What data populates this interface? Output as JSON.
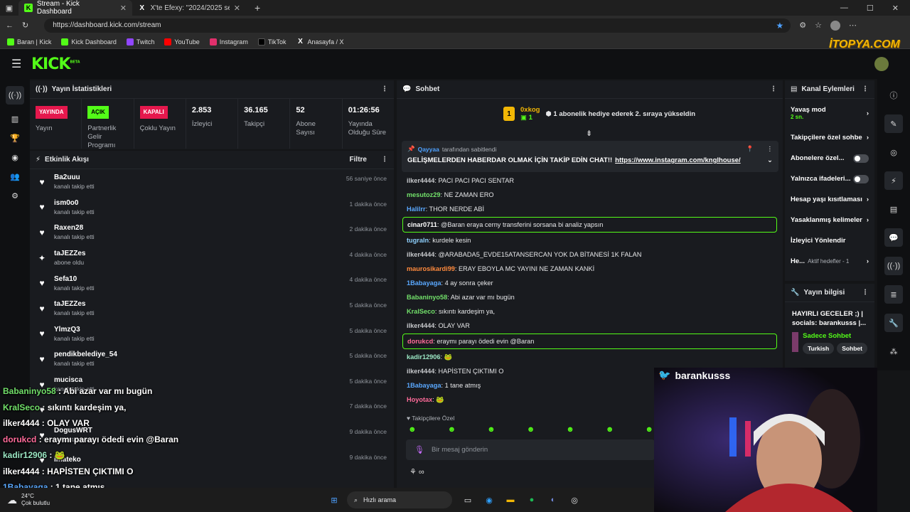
{
  "browser": {
    "tabs": [
      {
        "title": "Stream - Kick Dashboard"
      },
      {
        "title": "X'te Efexy: \"2024/2025 sezonund"
      }
    ],
    "url": "https://dashboard.kick.com/stream",
    "bookmarks": [
      "Baran | Kick",
      "Kick Dashboard",
      "Twitch",
      "YouTube",
      "Instagram",
      "TikTok",
      "Anasayfa / X"
    ]
  },
  "watermark": "İTOPYA.COM",
  "logo": {
    "text": "KICK",
    "sup": "BETA"
  },
  "stats": {
    "title": "Yayın İstatistikleri",
    "items": [
      {
        "badge": "YAYINDA",
        "label": "Yayın",
        "color": "#e5184d"
      },
      {
        "badge": "AÇIK",
        "label": "Partnerlik Gelir Programı",
        "color": "#53fc18"
      },
      {
        "badge": "KAPALI",
        "label": "Çoklu Yayın",
        "color": "#e5184d"
      },
      {
        "value": "2.853",
        "label": "İzleyici"
      },
      {
        "value": "36.165",
        "label": "Takipçi"
      },
      {
        "value": "52",
        "label": "Abone Sayısı"
      },
      {
        "value": "01:26:56",
        "label": "Yayında Olduğu Süre"
      }
    ]
  },
  "activity": {
    "title": "Etkinlik Akışı",
    "filter": "Filtre",
    "rows": [
      {
        "name": "Ba2uuu",
        "action": "kanalı takip etti",
        "time": "56 saniye önce",
        "icon": "heart"
      },
      {
        "name": "ism0o0",
        "action": "kanalı takip etti",
        "time": "1 dakika önce",
        "icon": "heart"
      },
      {
        "name": "Raxen28",
        "action": "kanalı takip etti",
        "time": "2 dakika önce",
        "icon": "heart"
      },
      {
        "name": "taJEZZes",
        "action": "abone oldu",
        "time": "4 dakika önce",
        "icon": "star"
      },
      {
        "name": "Sefa10",
        "action": "kanalı takip etti",
        "time": "4 dakika önce",
        "icon": "heart"
      },
      {
        "name": "taJEZZes",
        "action": "kanalı takip etti",
        "time": "5 dakika önce",
        "icon": "heart"
      },
      {
        "name": "YlmzQ3",
        "action": "kanalı takip etti",
        "time": "5 dakika önce",
        "icon": "heart"
      },
      {
        "name": "pendikbelediye_54",
        "action": "kanalı takip etti",
        "time": "5 dakika önce",
        "icon": "heart"
      },
      {
        "name": "mucisca",
        "action": "kanalı takip etti",
        "time": "5 dakika önce",
        "icon": "heart"
      },
      {
        "name": "",
        "action": "",
        "time": "7 dakika önce",
        "icon": "heart"
      },
      {
        "name": "DogusWRT",
        "action": "kanalı takip etti",
        "time": "9 dakika önce",
        "icon": "heart"
      },
      {
        "name": "imateko",
        "action": "",
        "time": "9 dakika önce",
        "icon": "heart"
      }
    ]
  },
  "chat": {
    "title": "Sohbet",
    "gift": {
      "user": "0xkog",
      "count": "1",
      "text": "1 abonelik hediye ederek 2. sıraya yükseldin"
    },
    "pinned": {
      "by": "Qayyaa",
      "by_suffix": "tarafından sabitlendi",
      "text": "GELİŞMELERDEN HABERDAR OLMAK İÇİN TAKİP EDİN CHAT!!",
      "link": "https://www.instagram.com/knglhouse/"
    },
    "messages": [
      {
        "user": "ilker4444",
        "color": "#c7c9cc",
        "text": "PACI PACI PACI SENTAR",
        "hl": false
      },
      {
        "user": "mesutoz29",
        "color": "#72e06a",
        "text": "NE ZAMAN ERO",
        "hl": false
      },
      {
        "user": "Halilrr",
        "color": "#5aa8ff",
        "text": "THOR NERDE ABİ",
        "hl": false
      },
      {
        "user": "cinar0711",
        "color": "#ffffff",
        "text": "@Baran eraya cerny transferini sorsana bi analiz yapsın",
        "hl": true
      },
      {
        "user": "tugraln",
        "color": "#8fd1ff",
        "text": "kurdele kesin",
        "hl": false
      },
      {
        "user": "ilker4444",
        "color": "#c7c9cc",
        "text": "@ARABADA5_EVDE15ATANSERCAN YOK DA BİTANESİ 1K FALAN",
        "hl": false
      },
      {
        "user": "maurosikardi99",
        "color": "#ff8a3d",
        "text": "ERAY EBOYLA MC YAYINI NE ZAMAN KANKİ",
        "hl": false
      },
      {
        "user": "1Babayaga",
        "color": "#5aa8ff",
        "text": "4 ay sonra çeker",
        "hl": false
      },
      {
        "user": "Babaninyo58",
        "color": "#72e06a",
        "text": "Abi azar var mı bugün",
        "hl": false
      },
      {
        "user": "KralSeco",
        "color": "#72e06a",
        "text": "sıkıntı kardeşim ya,",
        "hl": false
      },
      {
        "user": "ilker4444",
        "color": "#c7c9cc",
        "text": "OLAY VAR",
        "hl": false
      },
      {
        "user": "dorukcd",
        "color": "#ff6b9a",
        "text": "eraymı parayı ödedi evin @Baran",
        "hl": true
      },
      {
        "user": "kadir12906",
        "color": "#9be7c4",
        "text": "🐸",
        "hl": false
      },
      {
        "user": "ilker4444",
        "color": "#c7c9cc",
        "text": "HAPİSTEN ÇIKTIMI O",
        "hl": false
      },
      {
        "user": "1Babayaga",
        "color": "#5aa8ff",
        "text": "1 tane atmış",
        "hl": false
      },
      {
        "user": "Hoyotax",
        "color": "#ff6b9a",
        "text": "🐸",
        "hl": false
      }
    ],
    "followers_only": "Takipçilere Özel",
    "placeholder": "Bir mesaj gönderin"
  },
  "channel_actions": {
    "title": "Kanal Eylemleri",
    "items": [
      {
        "label": "Yavaş mod",
        "sub": "2 sn.",
        "type": "arrow"
      },
      {
        "label": "Takipçilere özel sohbe",
        "type": "arrow"
      },
      {
        "label": "Abonelere özel...",
        "type": "toggle"
      },
      {
        "label": "Yalnızca ifadeleri...",
        "type": "toggle"
      },
      {
        "label": "Hesap yaşı kısıtlaması",
        "type": "arrow"
      },
      {
        "label": "Yasaklanmış kelimeler",
        "type": "arrow"
      },
      {
        "label": "İzleyici Yönlendir",
        "type": "none"
      },
      {
        "label": "He...",
        "sub": "Aktif hedefler - 1",
        "type": "arrow"
      }
    ]
  },
  "stream_info": {
    "title": "Yayın bilgisi",
    "stream_title": "HAYIRLI GECELER ;) | socials: barankusss |...",
    "category": "Sadece Sohbet",
    "tags": [
      "Turkish",
      "Sohbet"
    ]
  },
  "overlay": {
    "handle": "barankusss",
    "lines": [
      {
        "user": "Babaninyo58",
        "color": "#72e06a",
        "text": ": Abi azar var mı bugün"
      },
      {
        "user": "KralSeco",
        "color": "#72e06a",
        "text": ": sıkıntı kardeşim ya,"
      },
      {
        "user": "ilker4444",
        "color": "#ffffff",
        "text": ": OLAY VAR"
      },
      {
        "user": "dorukcd",
        "color": "#ff6b9a",
        "text": ": eraymı parayı ödedi evin @Baran"
      },
      {
        "user": "kadir12906",
        "color": "#9be7c4",
        "text": ": 🐸"
      },
      {
        "user": "ilker4444",
        "color": "#ffffff",
        "text": ": HAPİSTEN ÇIKTIMI O"
      },
      {
        "user": "1Babayaga",
        "color": "#5aa8ff",
        "text": ": 1 tane atmış"
      }
    ]
  },
  "taskbar": {
    "temp": "24°C",
    "weather": "Çok bulutlu",
    "search": "Hızlı arama"
  }
}
